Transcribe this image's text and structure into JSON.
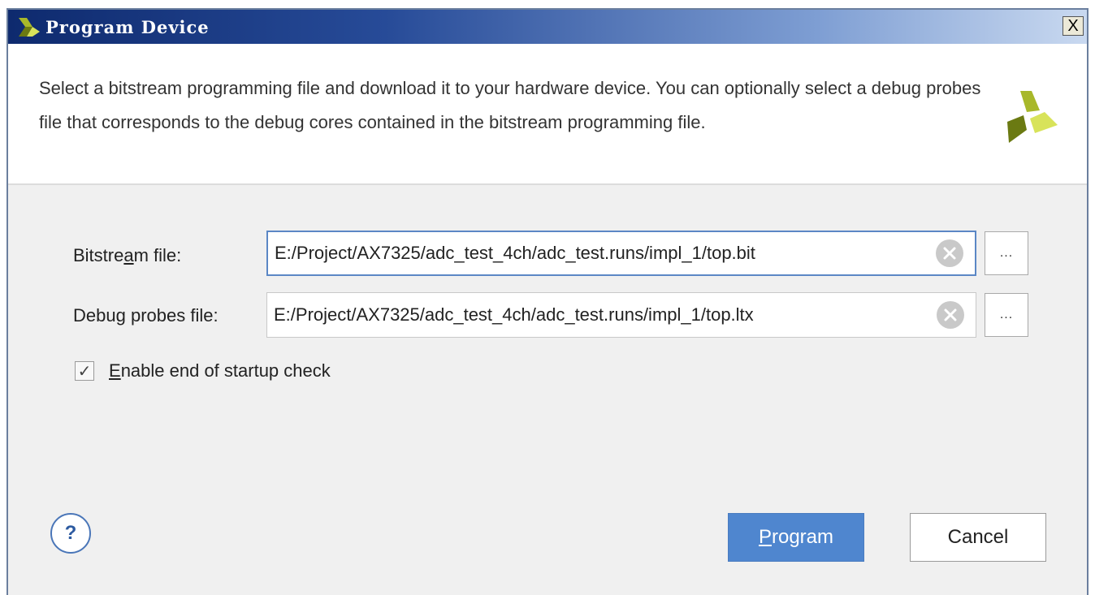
{
  "window": {
    "title": "Program Device",
    "close_glyph": "X"
  },
  "header": {
    "description": "Select a bitstream programming file and download it to your hardware device. You can optionally select a debug probes file that corresponds to the debug cores contained in the bitstream programming file.",
    "logo_icon": "vivado-logo-icon",
    "logo_colors": [
      "#6b7a12",
      "#a8b82a",
      "#d8e35a"
    ]
  },
  "form": {
    "bitstream": {
      "label_pre": "Bitstre",
      "label_mnemonic": "a",
      "label_post": "m file:",
      "value": "E:/Project/AX7325/adc_test_4ch/adc_test.runs/impl_1/top.bit",
      "browse_label": "..."
    },
    "debug_probes": {
      "label_pre": "Debu",
      "label_mnemonic": "g",
      "label_post": " probes file:",
      "value": "E:/Project/AX7325/adc_test_4ch/adc_test.runs/impl_1/top.ltx",
      "browse_label": "..."
    },
    "startup_check": {
      "checked": true,
      "check_glyph": "✓",
      "label_mnemonic": "E",
      "label_rest": "nable end of startup check"
    }
  },
  "footer": {
    "help_glyph": "?",
    "program_mnemonic": "P",
    "program_rest": "rogram",
    "cancel_label": "Cancel"
  },
  "colors": {
    "accent": "#4f86cf",
    "focus_border": "#5b87c5",
    "title_gradient_start": "#0e2a6e"
  }
}
